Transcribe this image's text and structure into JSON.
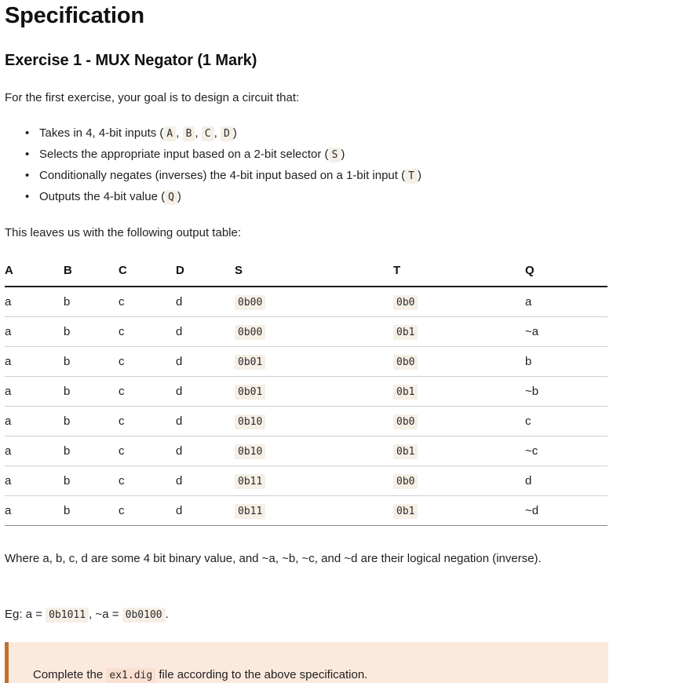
{
  "page": {
    "title": "Specification",
    "section_heading": "Exercise 1 - MUX Negator (1 Mark)",
    "intro_paragraph": "For the first exercise, your goal is to design a circuit that:",
    "table_lead_paragraph": "This leaves us with the following output table:",
    "where_paragraph": "Where a, b, c, d are some 4 bit binary value, and ~a, ~b, ~c, and ~d are their logical negation (inverse).",
    "eg_prefix": "Eg: a = ",
    "eg_value_a": "0b1011",
    "eg_middle": ", ~a = ",
    "eg_value_not_a": "0b0100",
    "eg_suffix": "."
  },
  "requirements": [
    {
      "lead": "Takes in 4, 4-bit inputs (",
      "codes": [
        "A",
        "B",
        "C",
        "D"
      ],
      "separator": ", ",
      "tail": ")"
    },
    {
      "lead": "Selects the appropriate input based on a 2-bit selector (",
      "codes": [
        "S"
      ],
      "separator": ", ",
      "tail": ")"
    },
    {
      "lead": "Conditionally negates (inverses) the 4-bit input based on a 1-bit input (",
      "codes": [
        "T"
      ],
      "separator": ", ",
      "tail": ")"
    },
    {
      "lead": "Outputs the 4-bit value (",
      "codes": [
        "Q"
      ],
      "separator": ", ",
      "tail": ")"
    }
  ],
  "output_table": {
    "headers": [
      "A",
      "B",
      "C",
      "D",
      "S",
      "T",
      "Q"
    ],
    "rows": [
      [
        "a",
        "b",
        "c",
        "d",
        "0b00",
        "0b0",
        "a"
      ],
      [
        "a",
        "b",
        "c",
        "d",
        "0b00",
        "0b1",
        "~a"
      ],
      [
        "a",
        "b",
        "c",
        "d",
        "0b01",
        "0b0",
        "b"
      ],
      [
        "a",
        "b",
        "c",
        "d",
        "0b01",
        "0b1",
        "~b"
      ],
      [
        "a",
        "b",
        "c",
        "d",
        "0b10",
        "0b0",
        "c"
      ],
      [
        "a",
        "b",
        "c",
        "d",
        "0b10",
        "0b1",
        "~c"
      ],
      [
        "a",
        "b",
        "c",
        "d",
        "0b11",
        "0b0",
        "d"
      ],
      [
        "a",
        "b",
        "c",
        "d",
        "0b11",
        "0b1",
        "~d"
      ]
    ],
    "mono_columns": [
      4,
      5
    ]
  },
  "callout": {
    "text_before": "Complete the ",
    "code": "ex1.dig",
    "text_after": " file according to the above specification."
  },
  "colors": {
    "code_background": "#f6efe6",
    "code_text": "#2b2b2b",
    "callout_background": "#fce9dd",
    "callout_border": "#c0702f",
    "callout_code_background": "#fbdfd0",
    "header_rule": "#1a1a1a",
    "row_rule": "#cfcfcf",
    "body_text": "#1f1f1f"
  }
}
